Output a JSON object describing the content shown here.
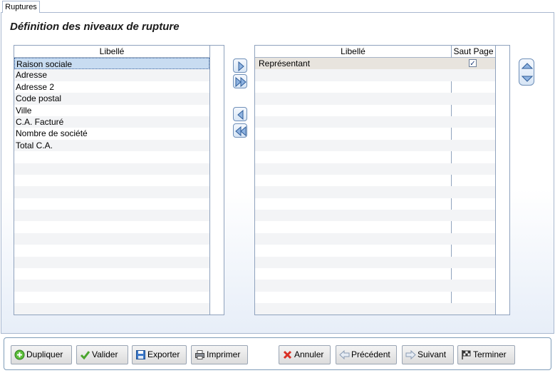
{
  "tab": {
    "label": "Ruptures"
  },
  "title": "Définition des niveaux de rupture",
  "left_grid": {
    "header": "Libellé",
    "rows": [
      "Raison sociale",
      "Adresse",
      "Adresse 2",
      "Code postal",
      "Ville",
      "C.A. Facturé",
      "Nombre de société",
      "Total C.A."
    ]
  },
  "right_grid": {
    "header_label": "Libellé",
    "header_saut": "Saut Page",
    "rows": [
      {
        "label": "Représentant",
        "saut_page": true
      }
    ]
  },
  "nav_buttons": {
    "add": "arrow-right-icon",
    "add_all": "double-arrow-right-icon",
    "remove": "arrow-left-icon",
    "remove_all": "double-arrow-left-icon",
    "move_up": "arrow-up-icon",
    "move_down": "arrow-down-icon"
  },
  "buttons": {
    "dupliquer": "Dupliquer",
    "valider": "Valider",
    "exporter": "Exporter",
    "imprimer": "Imprimer",
    "annuler": "Annuler",
    "precedent": "Précédent",
    "suivant": "Suivant",
    "terminer": "Terminer"
  },
  "colors": {
    "selection": "#c8dcf1",
    "border": "#8fa2bd",
    "accent": "#3a64a0"
  }
}
